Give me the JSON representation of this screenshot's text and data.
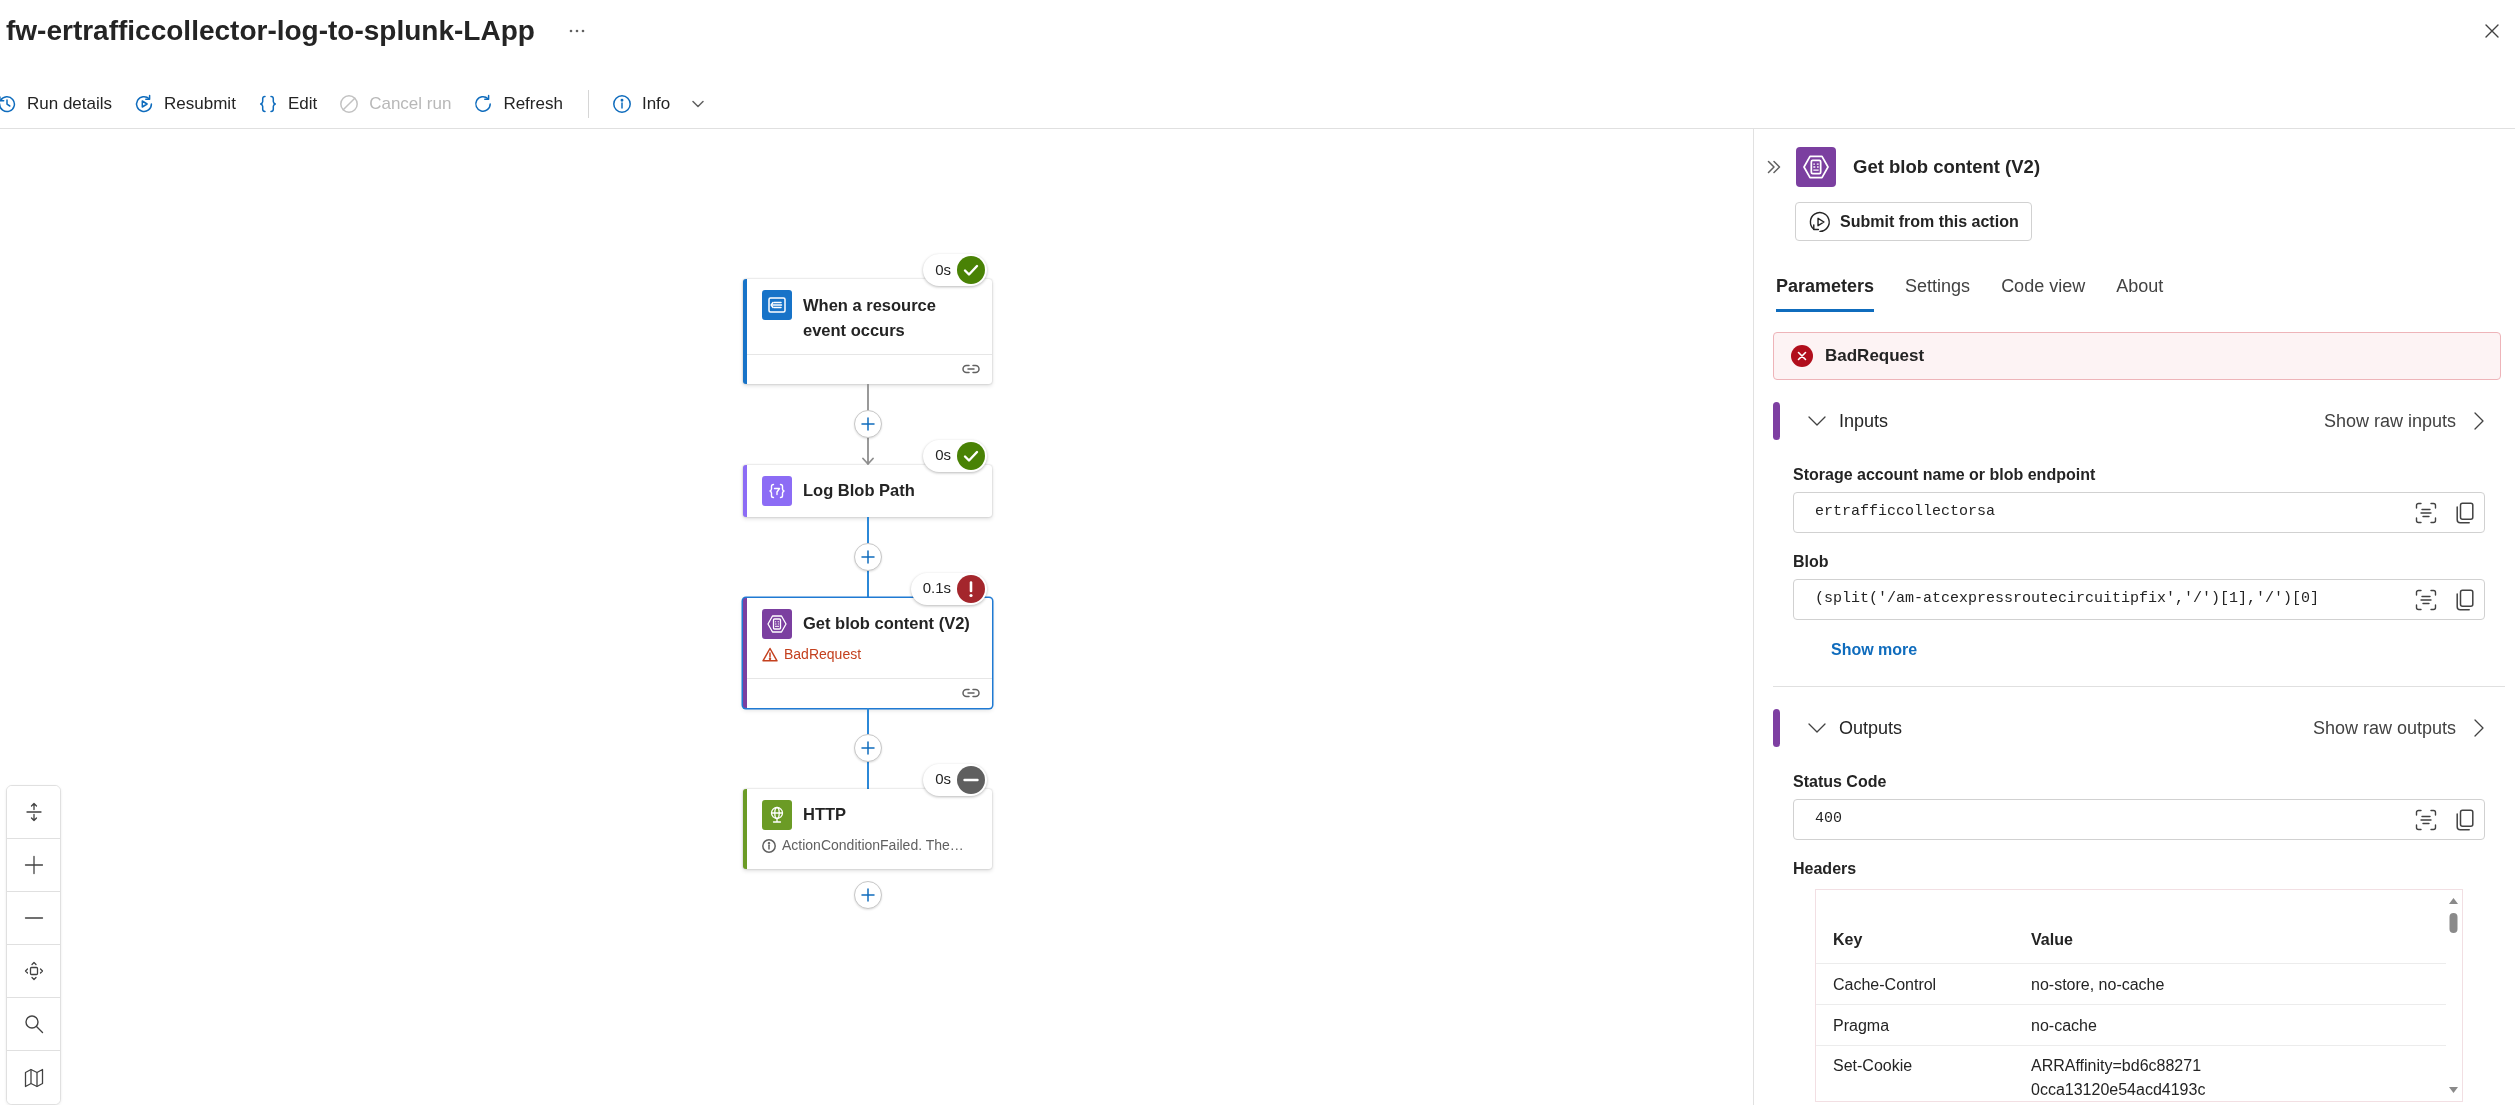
{
  "window": {
    "title": "fw-ertrafficcollector-log-to-splunk-LApp"
  },
  "toolbar_groups": [
    {
      "items": [
        {
          "label": "Run details",
          "kind": "history",
          "disabled": false,
          "dropdown": false
        },
        {
          "label": "Resubmit",
          "kind": "resubmit",
          "disabled": false,
          "dropdown": false
        },
        {
          "label": "Edit",
          "kind": "code",
          "disabled": false,
          "dropdown": false
        },
        {
          "label": "Cancel run",
          "kind": "cancel",
          "disabled": true,
          "dropdown": false
        },
        {
          "label": "Refresh",
          "kind": "refresh",
          "disabled": false,
          "dropdown": false
        }
      ]
    },
    {
      "items": [
        {
          "label": "Info",
          "kind": "info",
          "disabled": false,
          "dropdown": true
        }
      ]
    }
  ],
  "canvas": {
    "nodes": [
      {
        "kind": "event",
        "title": "When a resource event occurs",
        "color": "#1773c8",
        "badge": {
          "duration": "0s",
          "kind": "succeeded"
        },
        "selected": false,
        "connection": true
      },
      {
        "kind": "variable",
        "title": "Log Blob Path",
        "color": "#8c6cf5",
        "badge": {
          "duration": "0s",
          "kind": "succeeded"
        },
        "selected": false,
        "connection": false
      },
      {
        "kind": "blob",
        "title": "Get blob content (V2)",
        "color": "#7b3fa0",
        "badge": {
          "duration": "0.1s",
          "kind": "failed"
        },
        "selected": true,
        "connection": true,
        "message": {
          "kind": "error",
          "text": "BadRequest"
        }
      },
      {
        "kind": "http",
        "title": "HTTP",
        "color": "#6b9b25",
        "badge": {
          "duration": "0s",
          "kind": "skipped"
        },
        "selected": false,
        "connection": false,
        "message": {
          "kind": "info",
          "text": "ActionConditionFailed. The…"
        }
      }
    ],
    "connectors": [
      {
        "kind": "arrow"
      },
      {
        "kind": "line"
      },
      {
        "kind": "line"
      },
      {
        "kind": "none"
      }
    ]
  },
  "panel": {
    "kind": "blob",
    "title": "Get blob content (V2)",
    "submit_button": "Submit from this action",
    "tabs": [
      {
        "label": "Parameters",
        "selected": true
      },
      {
        "label": "Settings",
        "selected": false
      },
      {
        "label": "Code view",
        "selected": false
      },
      {
        "label": "About",
        "selected": false
      }
    ],
    "error": "BadRequest",
    "sections": [
      {
        "title": "Inputs",
        "expanded": true,
        "raw_link": "Show raw inputs",
        "fields": [
          {
            "kind": "text",
            "label": "Storage account name or blob endpoint",
            "value": "ertrafficcollectorsa"
          },
          {
            "kind": "text",
            "label": "Blob",
            "value": "(split('/am-atcexpressroutecircuitipfix','/')[1],'/')[0]"
          }
        ],
        "show_more": "Show more"
      },
      {
        "title": "Outputs",
        "expanded": true,
        "raw_link": "Show raw outputs",
        "fields": [
          {
            "kind": "text",
            "label": "Status Code",
            "value": "400"
          },
          {
            "kind": "table",
            "label": "Headers",
            "columns": [
              "Key",
              "Value"
            ],
            "rows": [
              [
                "Cache-Control",
                "no-store, no-cache"
              ],
              [
                "Pragma",
                "no-cache"
              ],
              [
                "Set-Cookie",
                "ARRAffinity=bd6c88271\n0cca13120e54acd4193c"
              ]
            ]
          }
        ]
      }
    ]
  }
}
